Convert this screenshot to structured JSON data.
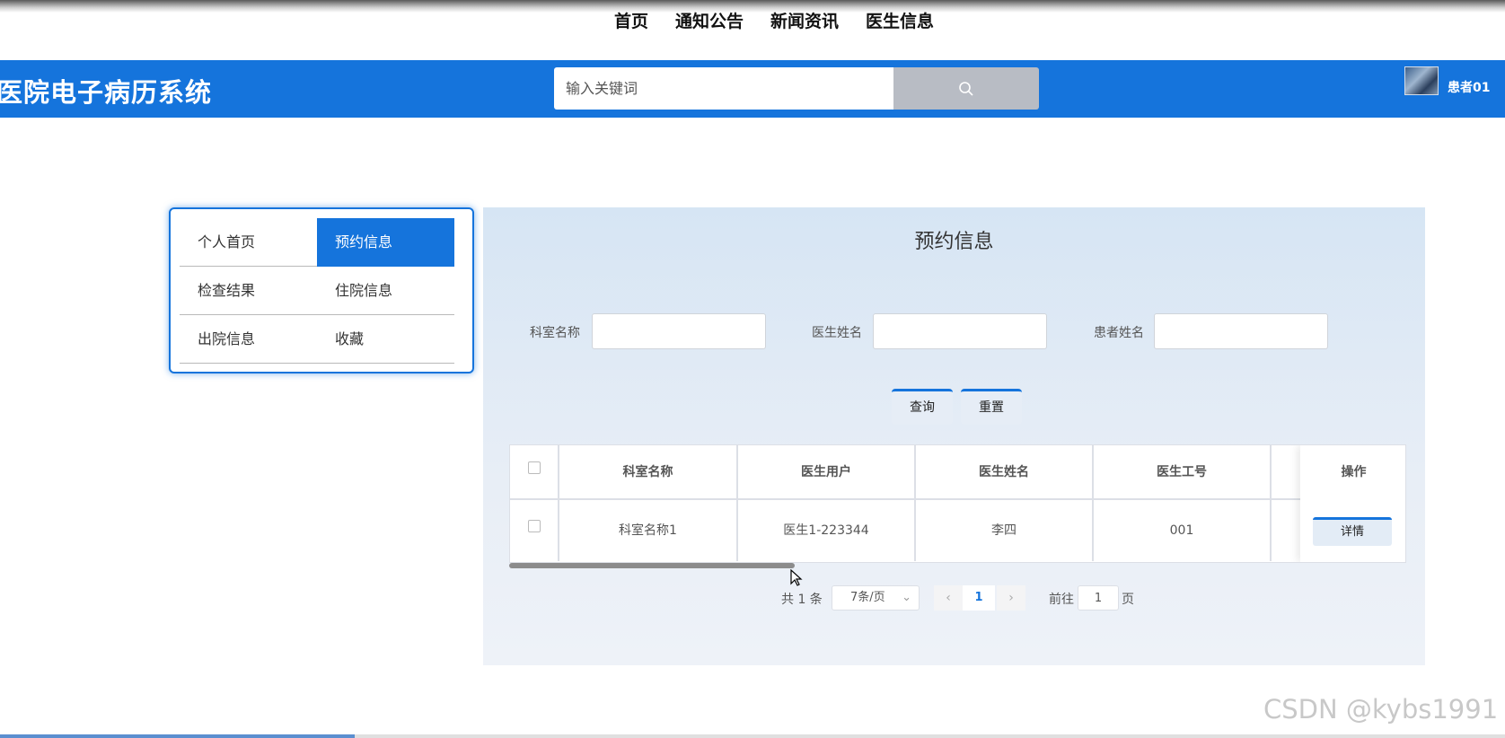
{
  "top_nav": {
    "items": [
      "首页",
      "通知公告",
      "新闻资讯",
      "医生信息"
    ]
  },
  "header": {
    "brand": "医院电子病历系统",
    "search_placeholder": "输入关键词",
    "user_name": "患者01"
  },
  "side_menu": {
    "items": [
      {
        "label": "个人首页"
      },
      {
        "label": "预约信息"
      },
      {
        "label": "检查结果"
      },
      {
        "label": "住院信息"
      },
      {
        "label": "出院信息"
      },
      {
        "label": "收藏"
      }
    ],
    "active": "预约信息"
  },
  "content": {
    "title": "预约信息",
    "filters": {
      "dept_label": "科室名称",
      "doctor_label": "医生姓名",
      "patient_label": "患者姓名"
    },
    "query_button": "查询",
    "reset_button": "重置",
    "table": {
      "headers": [
        "科室名称",
        "医生用户",
        "医生姓名",
        "医生工号",
        "操作"
      ],
      "rows": [
        {
          "dept": "科室名称1",
          "doctor_user": "医生1-223344",
          "doctor_name": "李四",
          "doctor_id": "001",
          "action": "详情"
        }
      ]
    },
    "pagination": {
      "total_text": "共 1 条",
      "page_size": "7条/页",
      "current_page": "1",
      "prev": "‹",
      "next": "›",
      "goto_label": "前往",
      "goto_value": "1",
      "page_suffix": "页"
    }
  },
  "watermark": "CSDN @kybs1991",
  "colors": {
    "primary": "#1574dc",
    "content_bg": "#dde8f4"
  }
}
